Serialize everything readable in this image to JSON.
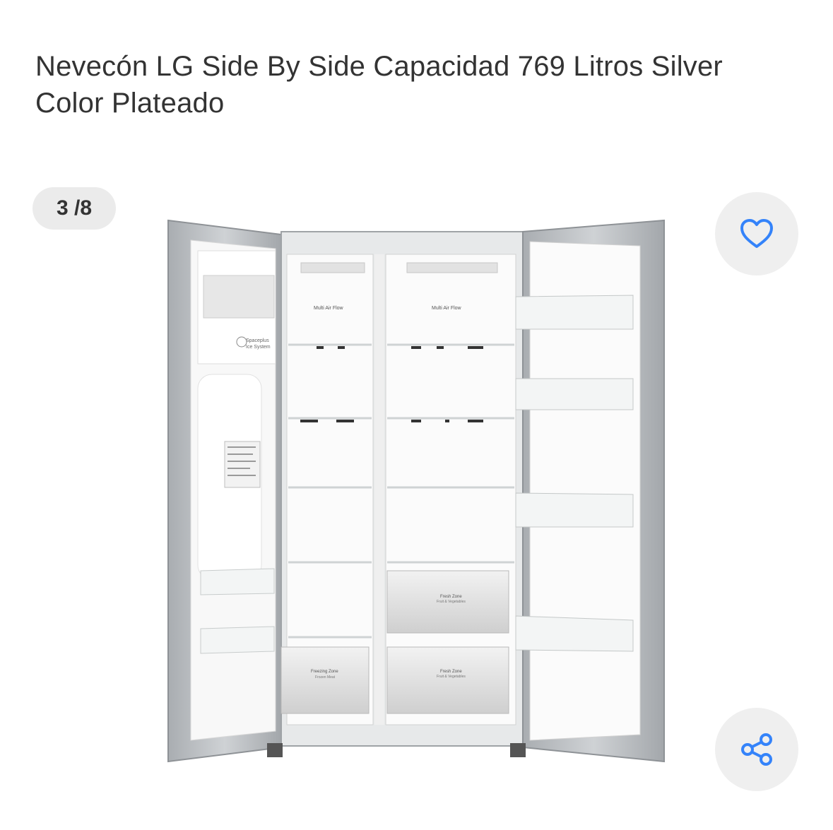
{
  "product": {
    "title": "Nevecón LG Side By Side Capacidad 769 Litros Silver Color Plateado"
  },
  "gallery": {
    "counter": "3 /8",
    "image_alt": "Nevera LG side by side abierta",
    "labels": {
      "multi_air_flow_left": "Multi Air Flow",
      "multi_air_flow_right": "Multi Air Flow",
      "spaceplus": "Spaceplus",
      "ice_system": "Ice System",
      "fresh_zone_top": "Fresh Zone",
      "fresh_zone_top_sub": "Fruit & Vegetables",
      "freezing_zone": "Freezing Zone",
      "freezing_zone_sub": "Frozen Meat",
      "fresh_zone_bottom": "Fresh Zone",
      "fresh_zone_bottom_sub": "Fruit & Vegetables"
    }
  },
  "actions": {
    "favorite_icon": "heart-icon",
    "share_icon": "share-icon"
  },
  "colors": {
    "accent": "#3483fa",
    "button_bg": "#efefef",
    "title": "#333333"
  }
}
